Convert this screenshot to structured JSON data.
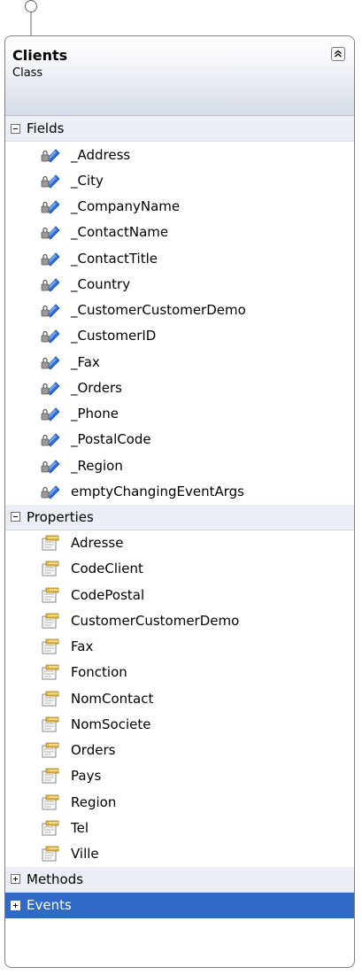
{
  "class_box": {
    "title": "Clients",
    "kind": "Class"
  },
  "sections": {
    "fields": {
      "label": "Fields",
      "expanded": true,
      "items": [
        "_Address",
        "_City",
        "_CompanyName",
        "_ContactName",
        "_ContactTitle",
        "_Country",
        "_CustomerCustomerDemo",
        "_CustomerID",
        "_Fax",
        "_Orders",
        "_Phone",
        "_PostalCode",
        "_Region",
        "emptyChangingEventArgs"
      ]
    },
    "properties": {
      "label": "Properties",
      "expanded": true,
      "items": [
        "Adresse",
        "CodeClient",
        "CodePostal",
        "CustomerCustomerDemo",
        "Fax",
        "Fonction",
        "NomContact",
        "NomSociete",
        "Orders",
        "Pays",
        "Region",
        "Tel",
        "Ville"
      ]
    },
    "methods": {
      "label": "Methods",
      "expanded": false
    },
    "events": {
      "label": "Events",
      "expanded": false,
      "selected": true
    }
  },
  "icons": {
    "field": "private-field-icon",
    "property": "property-icon",
    "collapse": "collapse-chevrons-icon",
    "interface": "interface-lollipop-icon"
  },
  "colors": {
    "selection": "#3169c6",
    "section_header": "#ebeef4",
    "field_icon": "#2f6fd6",
    "property_icon": "#e1b84a"
  }
}
